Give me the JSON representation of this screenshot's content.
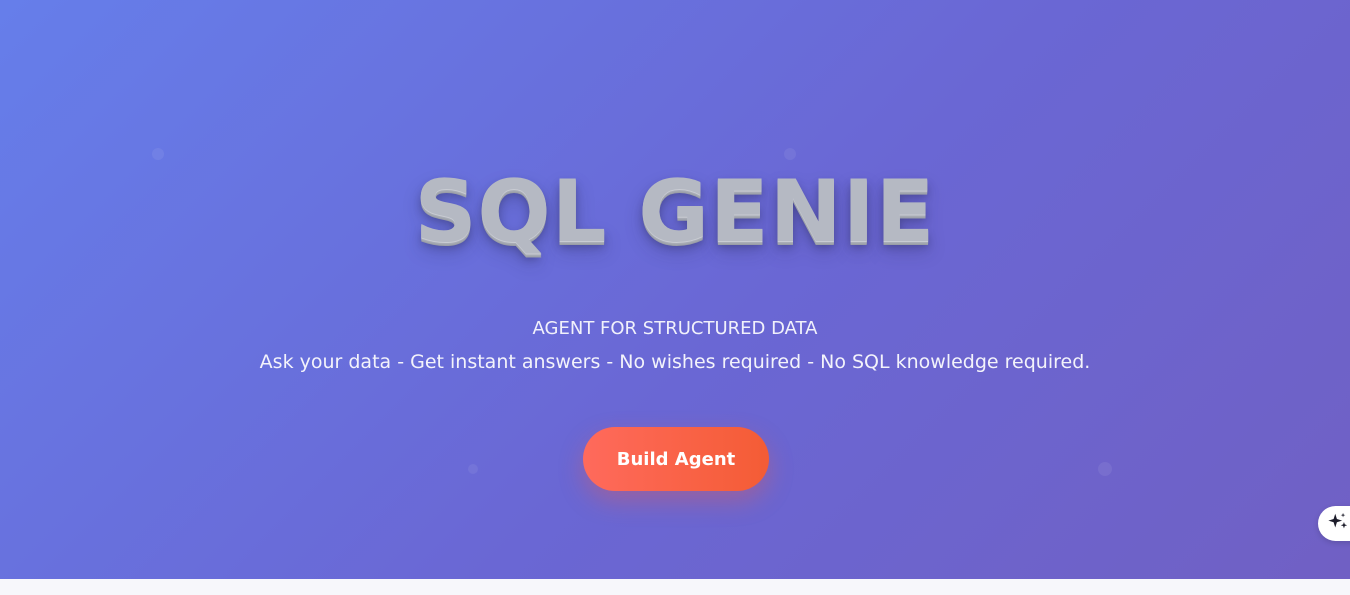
{
  "hero": {
    "title": "SQL GENIE",
    "subtitle": "AGENT FOR STRUCTURED DATA",
    "tagline": "Ask your data - Get instant answers - No wishes required - No SQL knowledge required.",
    "build_button_label": "Build Agent"
  },
  "floating_action": {
    "icon": "sparkle-icon"
  },
  "colors": {
    "gradient_start": "#667eea",
    "gradient_end": "#7060c4",
    "button_start": "#ff6a5c",
    "button_end": "#f45c35"
  }
}
